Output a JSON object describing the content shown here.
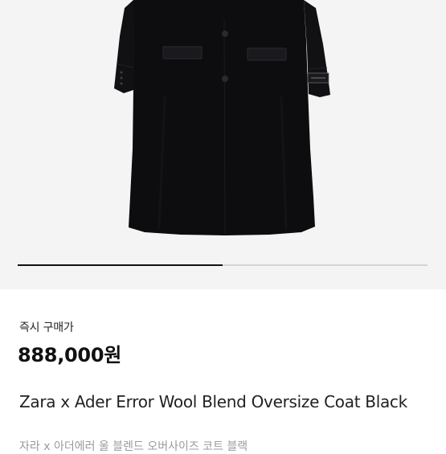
{
  "gallery": {
    "image_alt": "Black long wool coat",
    "progress_fraction": 0.5
  },
  "product": {
    "price_label": "즉시 구매가",
    "price": "888,000원",
    "title": "Zara x Ader Error Wool Blend Oversize Coat Black",
    "subtitle": "자라 x 아더에러 울 블렌드 오버사이즈 코트 블랙"
  },
  "colors": {
    "coat": "#0d0d0f",
    "background": "#f4f4f4",
    "progress_active": "#111111",
    "progress_track": "#d4d4d4"
  }
}
